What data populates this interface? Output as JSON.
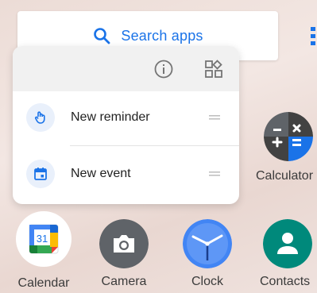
{
  "search": {
    "label": "Search apps"
  },
  "popup": {
    "items": [
      {
        "label": "New reminder"
      },
      {
        "label": "New event"
      }
    ]
  },
  "apps": {
    "calculator": "Calculator",
    "calendar": "Calendar",
    "calendar_day": "31",
    "camera": "Camera",
    "clock": "Clock",
    "contacts": "Contacts"
  },
  "colors": {
    "accent": "#1a73e8",
    "camera": "#5f6368",
    "clock": "#4285f4",
    "contacts": "#00897b",
    "calculator": "#424242"
  }
}
